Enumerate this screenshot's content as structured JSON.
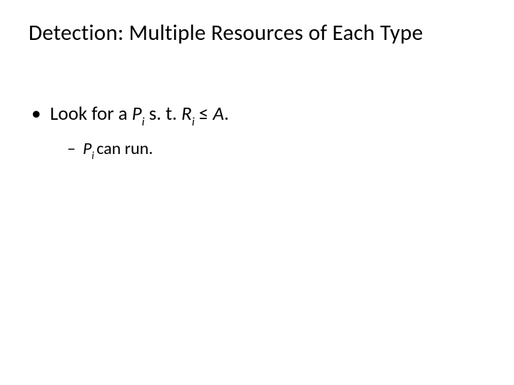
{
  "slide": {
    "title": "Detection: Multiple Resources of Each Type",
    "bullet1": {
      "lead": "Look for a ",
      "P": "P",
      "P_sub": "i",
      "mid": "   s. t.   ",
      "R": "R",
      "R_sub": "i",
      "leq": " ≤ ",
      "A": "A",
      "trail": "."
    },
    "bullet1_sub1": {
      "P": "P",
      "P_sub": "i ",
      "rest": "can run."
    }
  }
}
